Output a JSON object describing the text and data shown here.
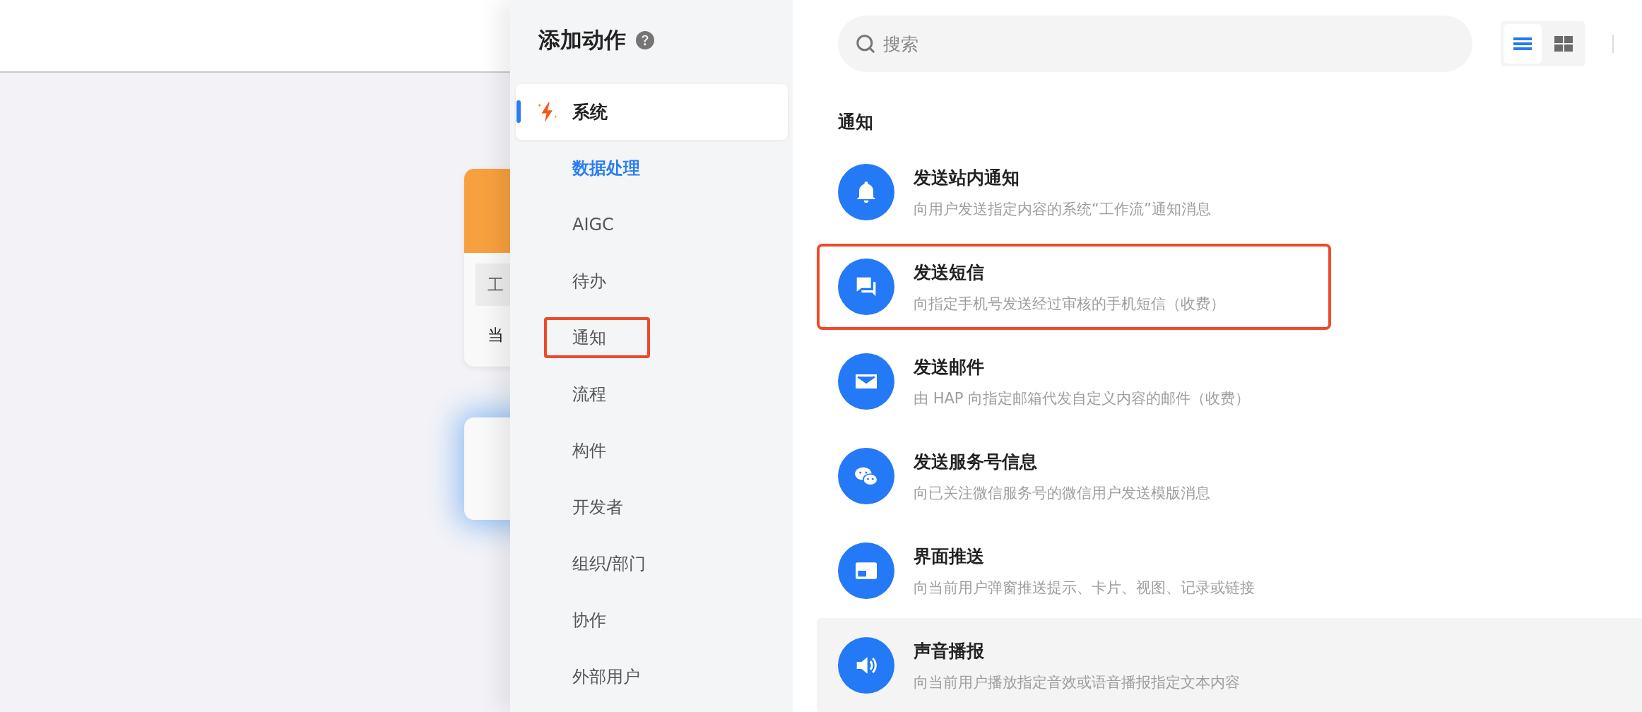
{
  "background_cards": [
    {
      "kind": "form",
      "field": "工",
      "text": "当"
    },
    {
      "kind": "glow"
    }
  ],
  "panel": {
    "title": "添加动作",
    "groups": [
      {
        "label": "系统",
        "selected": true,
        "children": [
          {
            "label": "数据处理",
            "selected": true,
            "highlighted": false
          },
          {
            "label": "AIGC",
            "selected": false,
            "highlighted": false
          },
          {
            "label": "待办",
            "selected": false,
            "highlighted": false
          },
          {
            "label": "通知",
            "selected": false,
            "highlighted": true
          },
          {
            "label": "流程",
            "selected": false,
            "highlighted": false
          },
          {
            "label": "构件",
            "selected": false,
            "highlighted": false
          },
          {
            "label": "开发者",
            "selected": false,
            "highlighted": false
          },
          {
            "label": "组织/部门",
            "selected": false,
            "highlighted": false
          },
          {
            "label": "协作",
            "selected": false,
            "highlighted": false
          },
          {
            "label": "外部用户",
            "selected": false,
            "highlighted": false
          }
        ]
      }
    ]
  },
  "search": {
    "placeholder": "搜索"
  },
  "view_modes": [
    {
      "kind": "list",
      "selected": true
    },
    {
      "kind": "grid",
      "selected": false
    }
  ],
  "section": {
    "title": "通知",
    "actions": [
      {
        "kind": "bell",
        "title": "发送站内通知",
        "description": "向用户发送指定内容的系统“工作流”通知消息",
        "highlighted": false,
        "hovered": false
      },
      {
        "kind": "chat",
        "title": "发送短信",
        "description": "向指定手机号发送经过审核的手机短信（收费）",
        "highlighted": true,
        "hovered": false
      },
      {
        "kind": "mail",
        "title": "发送邮件",
        "description": "由 HAP 向指定邮箱代发自定义内容的邮件（收费）",
        "highlighted": false,
        "hovered": false
      },
      {
        "kind": "wechat",
        "title": "发送服务号信息",
        "description": "向已关注微信服务号的微信用户发送模版消息",
        "highlighted": false,
        "hovered": false
      },
      {
        "kind": "window",
        "title": "界面推送",
        "description": "向当前用户弹窗推送提示、卡片、视图、记录或链接",
        "highlighted": false,
        "hovered": false
      },
      {
        "kind": "speaker",
        "title": "声音播报",
        "description": "向当前用户播放指定音效或语音播报指定文本内容",
        "highlighted": false,
        "hovered": true
      }
    ]
  }
}
